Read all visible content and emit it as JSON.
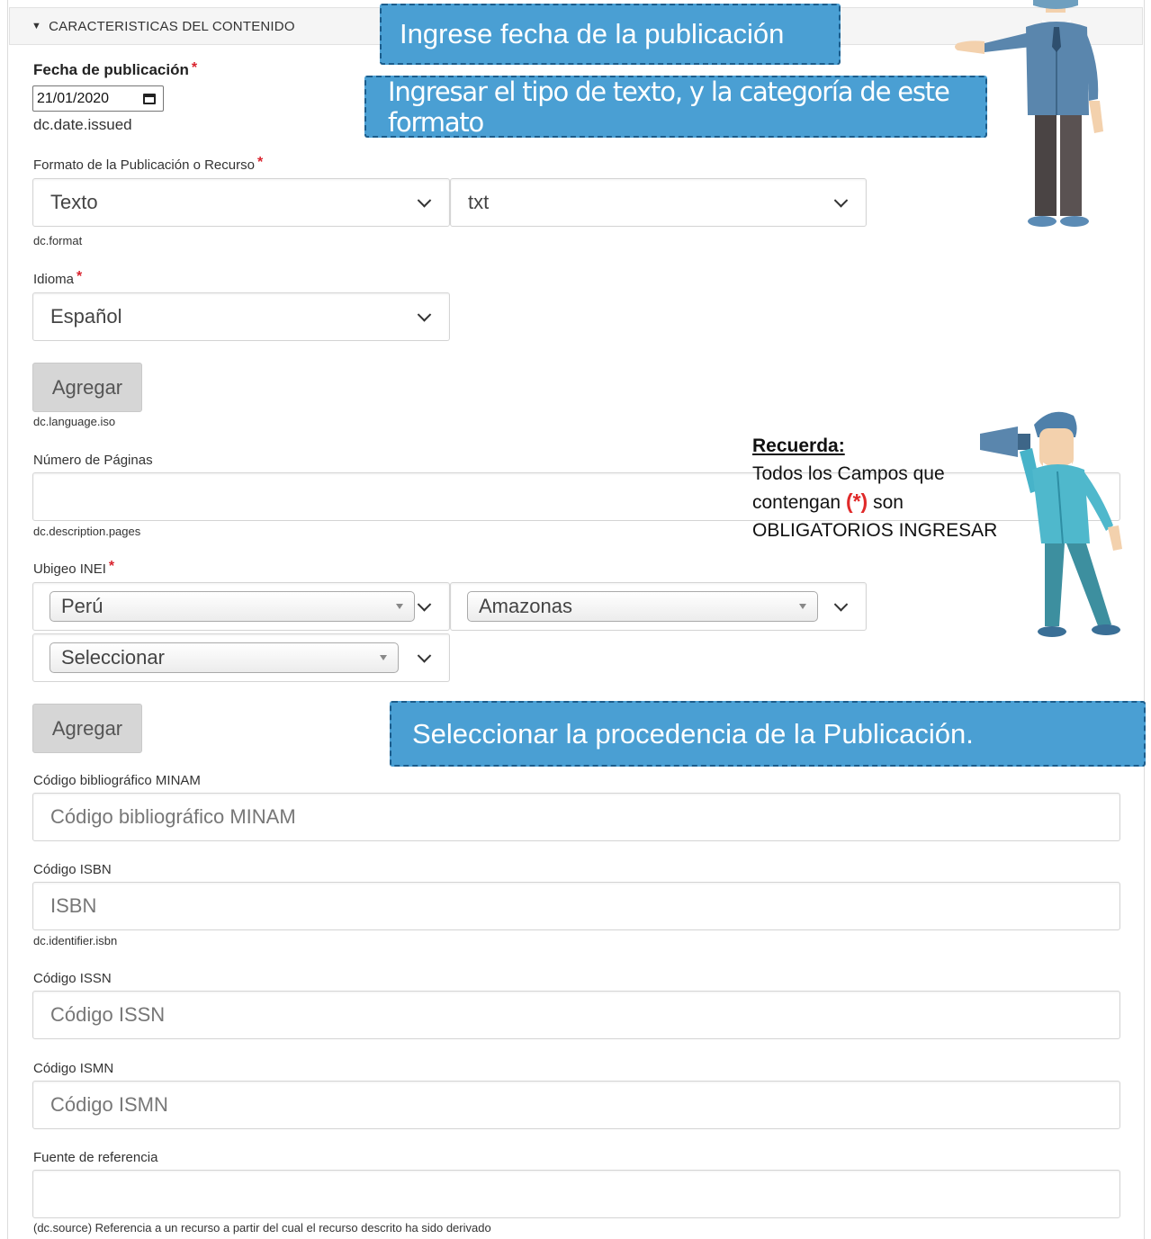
{
  "section": {
    "title": "CARACTERISTICAS DEL CONTENIDO"
  },
  "fecha": {
    "label": "Fecha de publicación",
    "required": "*",
    "value": "21/01/2020",
    "hint": "dc.date.issued"
  },
  "formato": {
    "label": "Formato de la Publicación o Recurso",
    "required": "*",
    "type_value": "Texto",
    "category_value": "txt",
    "hint": "dc.format"
  },
  "idioma": {
    "label": "Idioma",
    "required": "*",
    "value": "Español",
    "add_label": "Agregar",
    "hint": "dc.language.iso"
  },
  "paginas": {
    "label": "Número de Páginas",
    "value": "",
    "hint": "dc.description.pages"
  },
  "ubigeo": {
    "label": "Ubigeo INEI",
    "required": "*",
    "pais": "Perú",
    "departamento": "Amazonas",
    "provincia": "Seleccionar",
    "add_label": "Agregar"
  },
  "codigo_minam": {
    "label": "Código bibliográfico MINAM",
    "placeholder": "Código bibliográfico MINAM"
  },
  "isbn": {
    "label": "Código ISBN",
    "placeholder": "ISBN",
    "hint": "dc.identifier.isbn"
  },
  "issn": {
    "label": "Código ISSN",
    "placeholder": "Código ISSN"
  },
  "ismn": {
    "label": "Código ISMN",
    "placeholder": "Código ISMN"
  },
  "fuente": {
    "label": "Fuente de referencia",
    "value": "",
    "hint": "(dc.source) Referencia a un recurso a partir del cual el recurso descrito ha sido derivado"
  },
  "callouts": {
    "fecha": "Ingrese fecha de la publicación",
    "formato": "Ingresar el tipo de texto, y la categoría de este formato",
    "procedencia": "Seleccionar la procedencia de la Publicación."
  },
  "recuerda": {
    "title": "Recuerda:",
    "line1": "Todos los Campos que",
    "line2_pre": "contengan",
    "line2_ast": "(*)",
    "line2_post": "son",
    "line3": "OBLIGATORIOS INGRESAR"
  },
  "colors": {
    "callout_bg": "#4a9fd3",
    "callout_border": "#1c5d8c",
    "required": "#d9232e",
    "button_bg": "#d6d6d6"
  }
}
